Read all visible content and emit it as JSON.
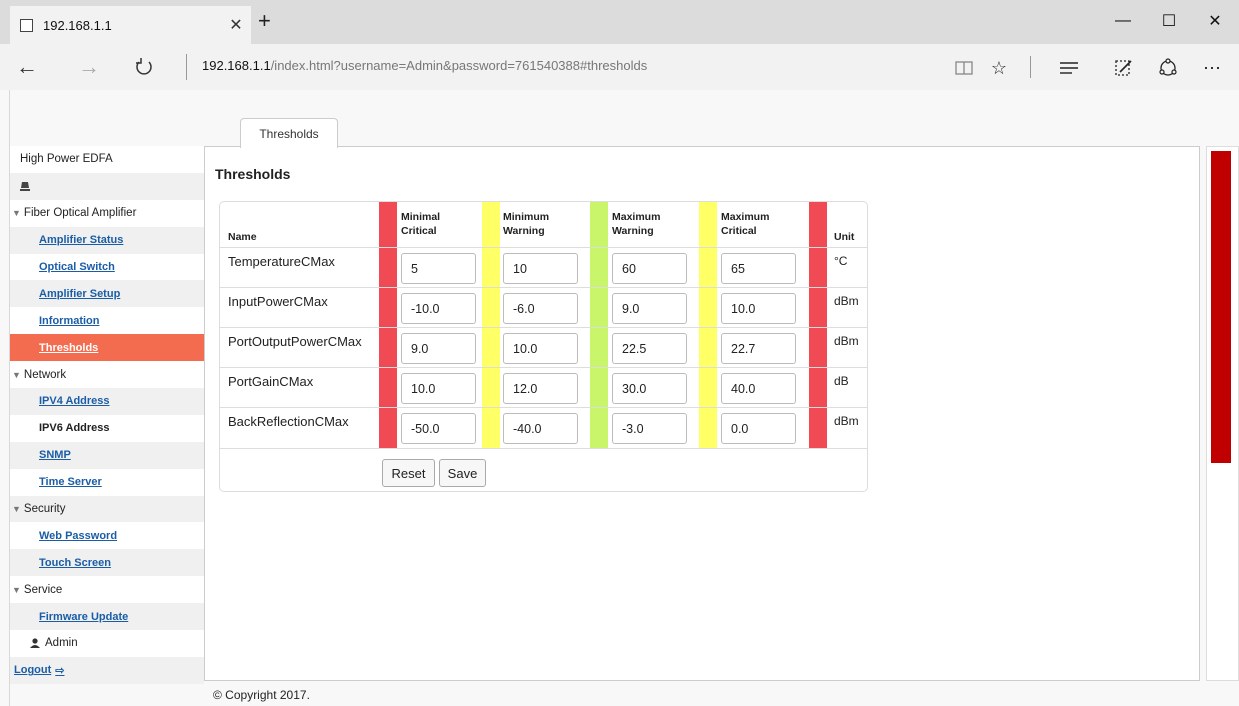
{
  "browser": {
    "tab_title": "192.168.1.1",
    "url_host": "192.168.1.1",
    "url_rest": "/index.html?username=Admin&password=761540388#thresholds"
  },
  "sidebar": {
    "device_title": "High Power EDFA",
    "groups": {
      "fiber": "Fiber Optical Amplifier",
      "network": "Network",
      "security": "Security",
      "service": "Service"
    },
    "items": {
      "amplifier_status": "Amplifier Status",
      "optical_switch": "Optical Switch",
      "amplifier_setup": "Amplifier Setup",
      "information": "Information",
      "thresholds": "Thresholds",
      "ipv4": "IPV4 Address",
      "ipv6": "IPV6 Address",
      "snmp": "SNMP",
      "time_server": "Time Server",
      "web_password": "Web Password",
      "touch_screen": "Touch Screen",
      "firmware_update": "Firmware Update"
    },
    "user": "Admin",
    "logout": "Logout"
  },
  "main": {
    "tab_label": "Thresholds",
    "section_title": "Thresholds",
    "columns": {
      "name": "Name",
      "min_critical": [
        "Minimal",
        "Critical"
      ],
      "min_warning": [
        "Minimum",
        "Warning"
      ],
      "max_warning": [
        "Maximum",
        "Warning"
      ],
      "max_critical": [
        "Maximum",
        "Critical"
      ],
      "unit": "Unit"
    },
    "rows": [
      {
        "name": "TemperatureCMax",
        "min_critical": "5",
        "min_warning": "10",
        "max_warning": "60",
        "max_critical": "65",
        "unit": "°C"
      },
      {
        "name": "InputPowerCMax",
        "min_critical": "-10.0",
        "min_warning": "-6.0",
        "max_warning": "9.0",
        "max_critical": "10.0",
        "unit": "dBm"
      },
      {
        "name": "PortOutputPowerCMax",
        "min_critical": "9.0",
        "min_warning": "10.0",
        "max_warning": "22.5",
        "max_critical": "22.7",
        "unit": "dBm"
      },
      {
        "name": "PortGainCMax",
        "min_critical": "10.0",
        "min_warning": "12.0",
        "max_warning": "30.0",
        "max_critical": "40.0",
        "unit": "dB"
      },
      {
        "name": "BackReflectionCMax",
        "min_critical": "-50.0",
        "min_warning": "-40.0",
        "max_warning": "-3.0",
        "max_critical": "0.0",
        "unit": "dBm"
      }
    ],
    "reset_label": "Reset",
    "save_label": "Save"
  },
  "footer": {
    "copyright": "© Copyright 2017."
  },
  "colors": {
    "critical": "#f04b55",
    "warning": "#ffff66",
    "ok": "#c8f56a",
    "active_item": "#f36c4f",
    "link": "#1a5da6",
    "scroll_thumb": "#c00000"
  }
}
